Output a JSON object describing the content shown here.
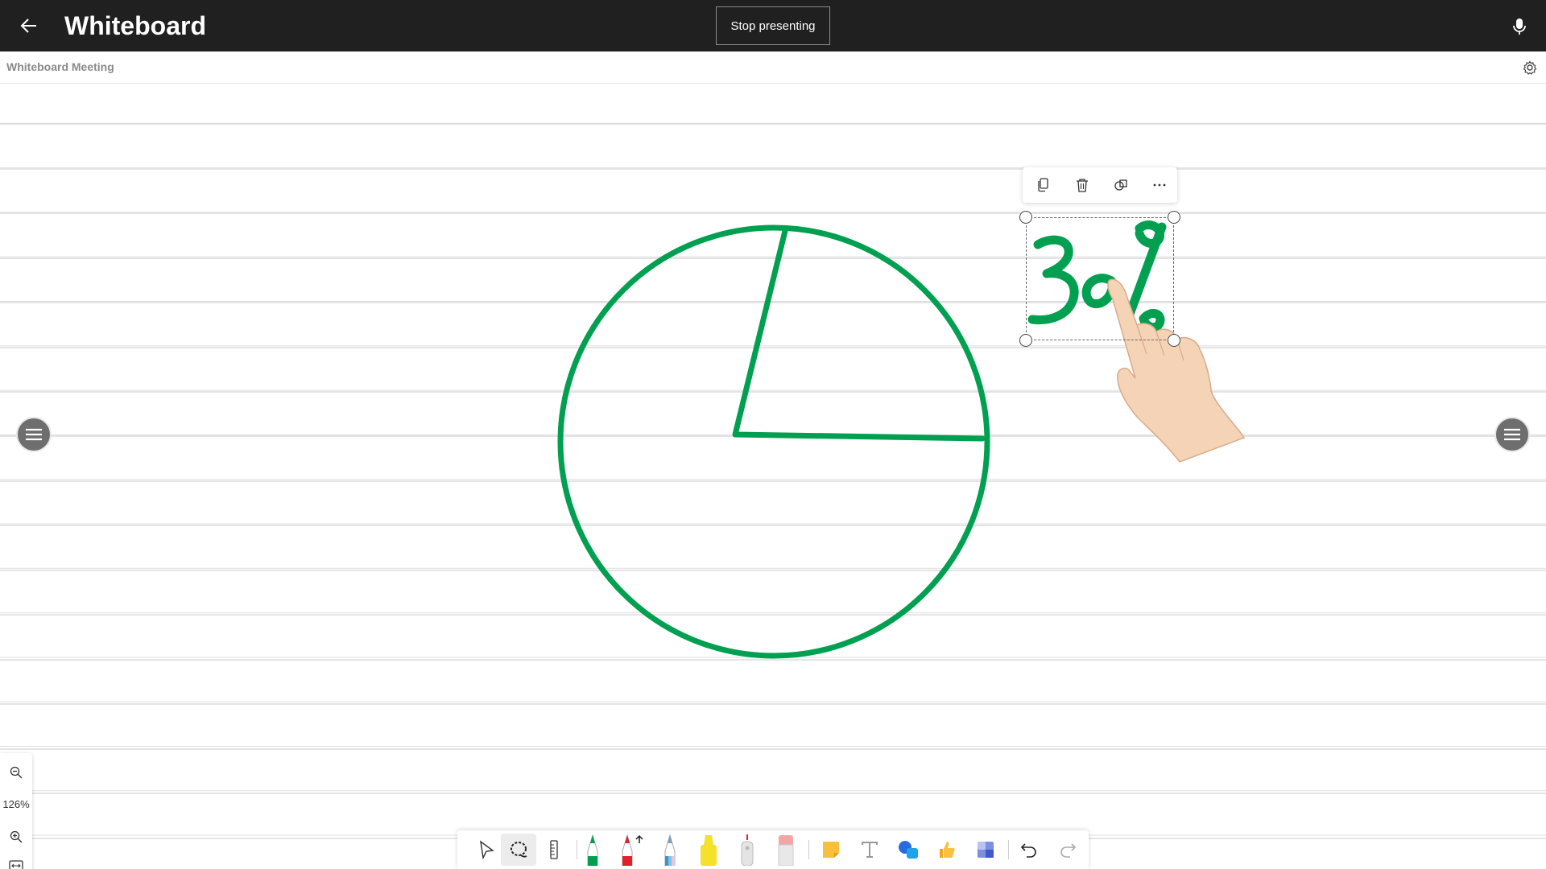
{
  "topbar": {
    "title": "Whiteboard",
    "stop_presenting_label": "Stop presenting",
    "back_icon": "arrow-left-icon",
    "mic_icon": "microphone-icon"
  },
  "subbar": {
    "meeting_name": "Whiteboard Meeting",
    "settings_icon": "gear-icon"
  },
  "zoom": {
    "level": "126%"
  },
  "whiteboard": {
    "ink_color": "#00a050",
    "ink_text": "30%",
    "pie_slice_fraction": 0.3
  },
  "selection_toolbar": {
    "items": [
      "copy-icon",
      "delete-icon",
      "convert-to-shape-icon",
      "more-options-icon"
    ]
  },
  "bottom_toolbar": {
    "tools": [
      "select",
      "lasso-select",
      "ruler",
      "green-pen",
      "red-pen",
      "rainbow-pen",
      "yellow-highlighter",
      "laser-pointer",
      "eraser",
      "sticky-note",
      "text",
      "shapes",
      "reactions",
      "templates",
      "undo",
      "redo"
    ]
  },
  "colors": {
    "topbar_bg": "#202020",
    "ink_green": "#00a050",
    "pen_red": "#e0202a",
    "highlighter_yellow": "#f5e02a"
  }
}
